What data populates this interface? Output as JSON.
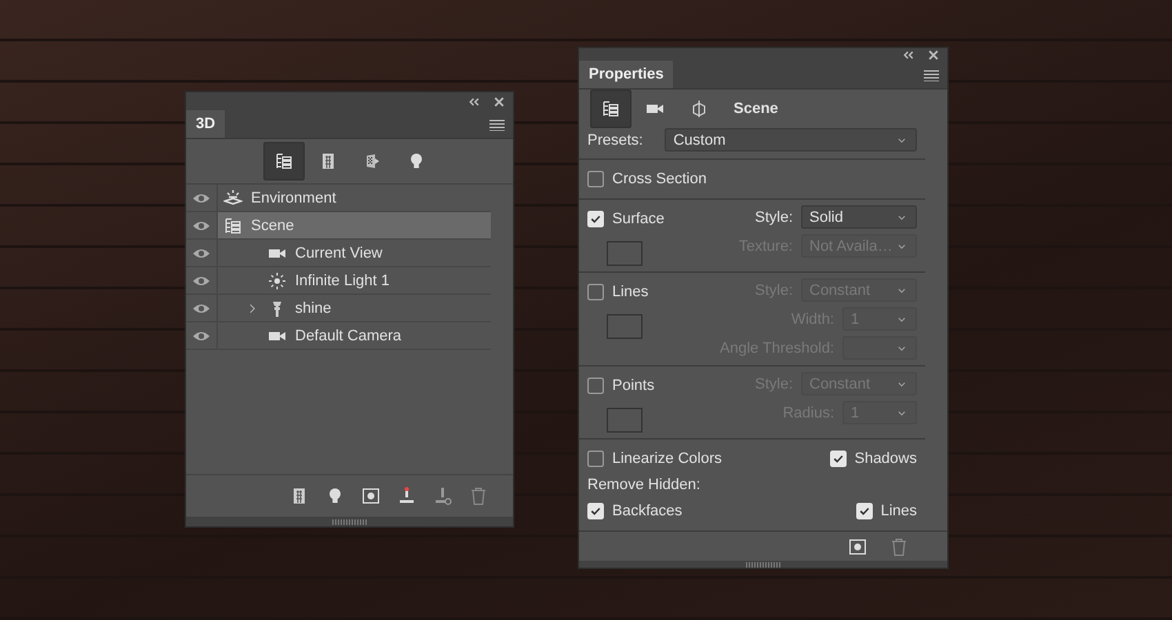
{
  "panel_3d": {
    "tab": "3D",
    "filters": [
      {
        "kind": "scene",
        "selected": true
      },
      {
        "kind": "mesh",
        "selected": false
      },
      {
        "kind": "material",
        "selected": false
      },
      {
        "kind": "light",
        "selected": false
      }
    ],
    "tree": [
      {
        "label": "Environment",
        "kind": "environment",
        "visible": true,
        "selected": false
      },
      {
        "label": "Scene",
        "kind": "scene",
        "visible": true,
        "selected": true,
        "children": [
          {
            "label": "Current View",
            "kind": "camera",
            "visible": true,
            "selected": false
          },
          {
            "label": "Infinite Light 1",
            "kind": "light",
            "visible": true,
            "selected": false
          },
          {
            "label": "shine",
            "kind": "mesh",
            "visible": true,
            "selected": false,
            "expanded": false
          },
          {
            "label": "Default Camera",
            "kind": "camera",
            "visible": true,
            "selected": false
          }
        ]
      }
    ]
  },
  "properties": {
    "tab": "Properties",
    "modes": [
      {
        "kind": "scene",
        "selected": true
      },
      {
        "kind": "camera",
        "selected": false
      },
      {
        "kind": "coordinates",
        "selected": false
      }
    ],
    "title": "Scene",
    "presets": {
      "label": "Presets:",
      "value": "Custom"
    },
    "cross_section": {
      "label": "Cross Section",
      "checked": false
    },
    "groups": [
      {
        "label": "Surface",
        "checked": true,
        "fields": [
          {
            "label": "Style:",
            "value": "Solid",
            "kind": "wide",
            "disabled": false
          },
          {
            "label": "Texture:",
            "value": "Not Availa…",
            "kind": "wide",
            "disabled": true
          }
        ]
      },
      {
        "label": "Lines",
        "checked": false,
        "fields": [
          {
            "label": "Style:",
            "value": "Constant",
            "kind": "wide",
            "disabled": true
          },
          {
            "label": "Width:",
            "value": "1",
            "kind": "narrow",
            "disabled": true
          },
          {
            "label": "Angle Threshold:",
            "kind": "narrow",
            "disabled": true
          }
        ]
      },
      {
        "label": "Points",
        "checked": false,
        "fields": [
          {
            "label": "Style:",
            "value": "Constant",
            "kind": "wide",
            "disabled": true
          },
          {
            "label": "Radius:",
            "value": "1",
            "kind": "narrow",
            "disabled": true
          }
        ]
      }
    ],
    "options": [
      {
        "label": "Linearize Colors",
        "checked": false
      },
      {
        "label": "Shadows",
        "checked": true
      }
    ],
    "remove_hidden": {
      "label": "Remove Hidden:",
      "options": [
        {
          "label": "Backfaces",
          "checked": true
        },
        {
          "label": "Lines",
          "checked": true
        }
      ]
    }
  }
}
